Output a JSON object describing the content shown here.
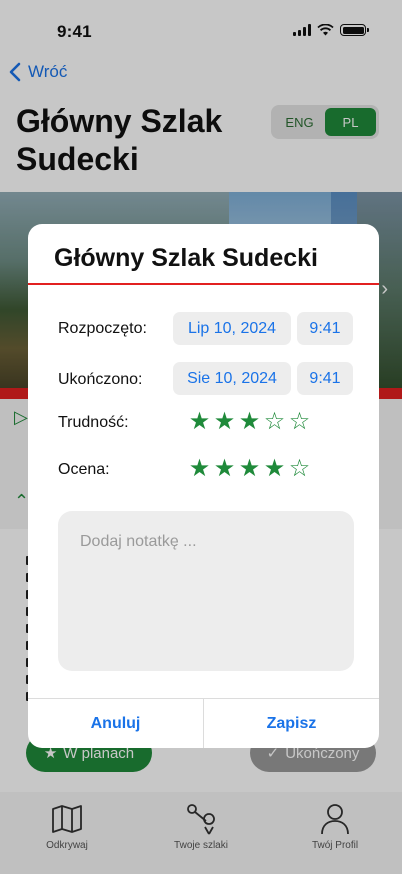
{
  "status_bar": {
    "time": "9:41"
  },
  "nav": {
    "back_label": "Wróć"
  },
  "page": {
    "title": "Główny Szlak Sudecki"
  },
  "language_toggle": {
    "options": [
      "ENG",
      "PL"
    ],
    "selected": "PL"
  },
  "background_actions": {
    "planned_label": "W planach",
    "completed_label": "Ukończony"
  },
  "tab_bar": {
    "items": [
      {
        "label": "Odkrywaj",
        "icon": "map-icon"
      },
      {
        "label": "Twoje szlaki",
        "icon": "route-icon"
      },
      {
        "label": "Twój Profil",
        "icon": "profile-icon"
      }
    ]
  },
  "modal": {
    "title": "Główny Szlak Sudecki",
    "started": {
      "label": "Rozpoczęto:",
      "date": "Lip 10, 2024",
      "time": "9:41"
    },
    "finished": {
      "label": "Ukończono:",
      "date": "Sie 10, 2024",
      "time": "9:41"
    },
    "difficulty": {
      "label": "Trudność:",
      "value": 3,
      "max": 5
    },
    "rating": {
      "label": "Ocena:",
      "value": 4,
      "max": 5
    },
    "note": {
      "placeholder": "Dodaj notatkę ...",
      "value": ""
    },
    "cancel_label": "Anuluj",
    "save_label": "Zapisz"
  },
  "colors": {
    "accent_green": "#1f8a3a",
    "link_blue": "#1a73e8",
    "trail_red": "#e22020",
    "chip_bg": "#ededed"
  }
}
